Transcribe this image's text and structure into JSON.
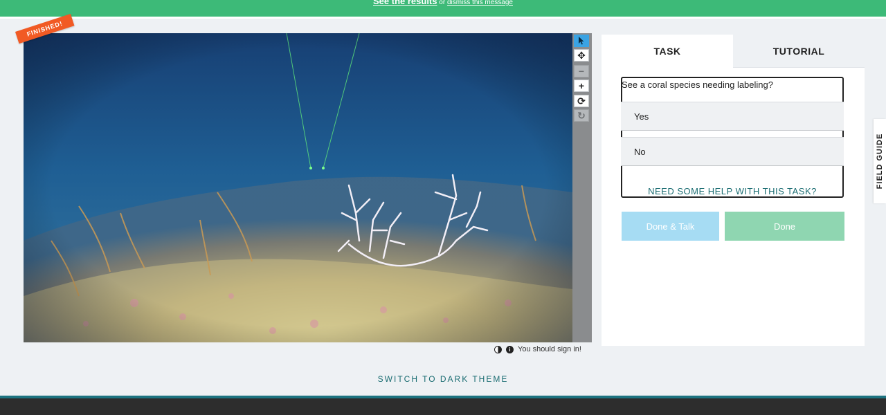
{
  "banner": {
    "results_link": "See the results",
    "or_text": " or ",
    "dismiss_link": "dismiss this message"
  },
  "subject": {
    "ribbon": "FINISHED!"
  },
  "toolbar": {
    "tools": [
      "pointer-icon",
      "move-icon",
      "zoom-out-icon",
      "zoom-in-icon",
      "rotate-icon",
      "reset-icon"
    ]
  },
  "under_image": {
    "sign_in": "You should sign in!"
  },
  "tabs": {
    "task": "TASK",
    "tutorial": "TUTORIAL"
  },
  "task": {
    "question": "See a coral species needing labeling?",
    "answers": [
      "Yes",
      "No"
    ],
    "help": "NEED SOME HELP WITH THIS TASK?"
  },
  "buttons": {
    "done_talk": "Done & Talk",
    "done": "Done"
  },
  "field_guide": "FIELD GUIDE",
  "theme_switch": "SWITCH TO DARK THEME",
  "colors": {
    "banner": "#3dba78",
    "ribbon": "#f15a24",
    "teal_text": "#1b6d72",
    "done_talk": "#a6dcf3",
    "done": "#8fd6b1",
    "active_tool": "#3aa3e3"
  }
}
